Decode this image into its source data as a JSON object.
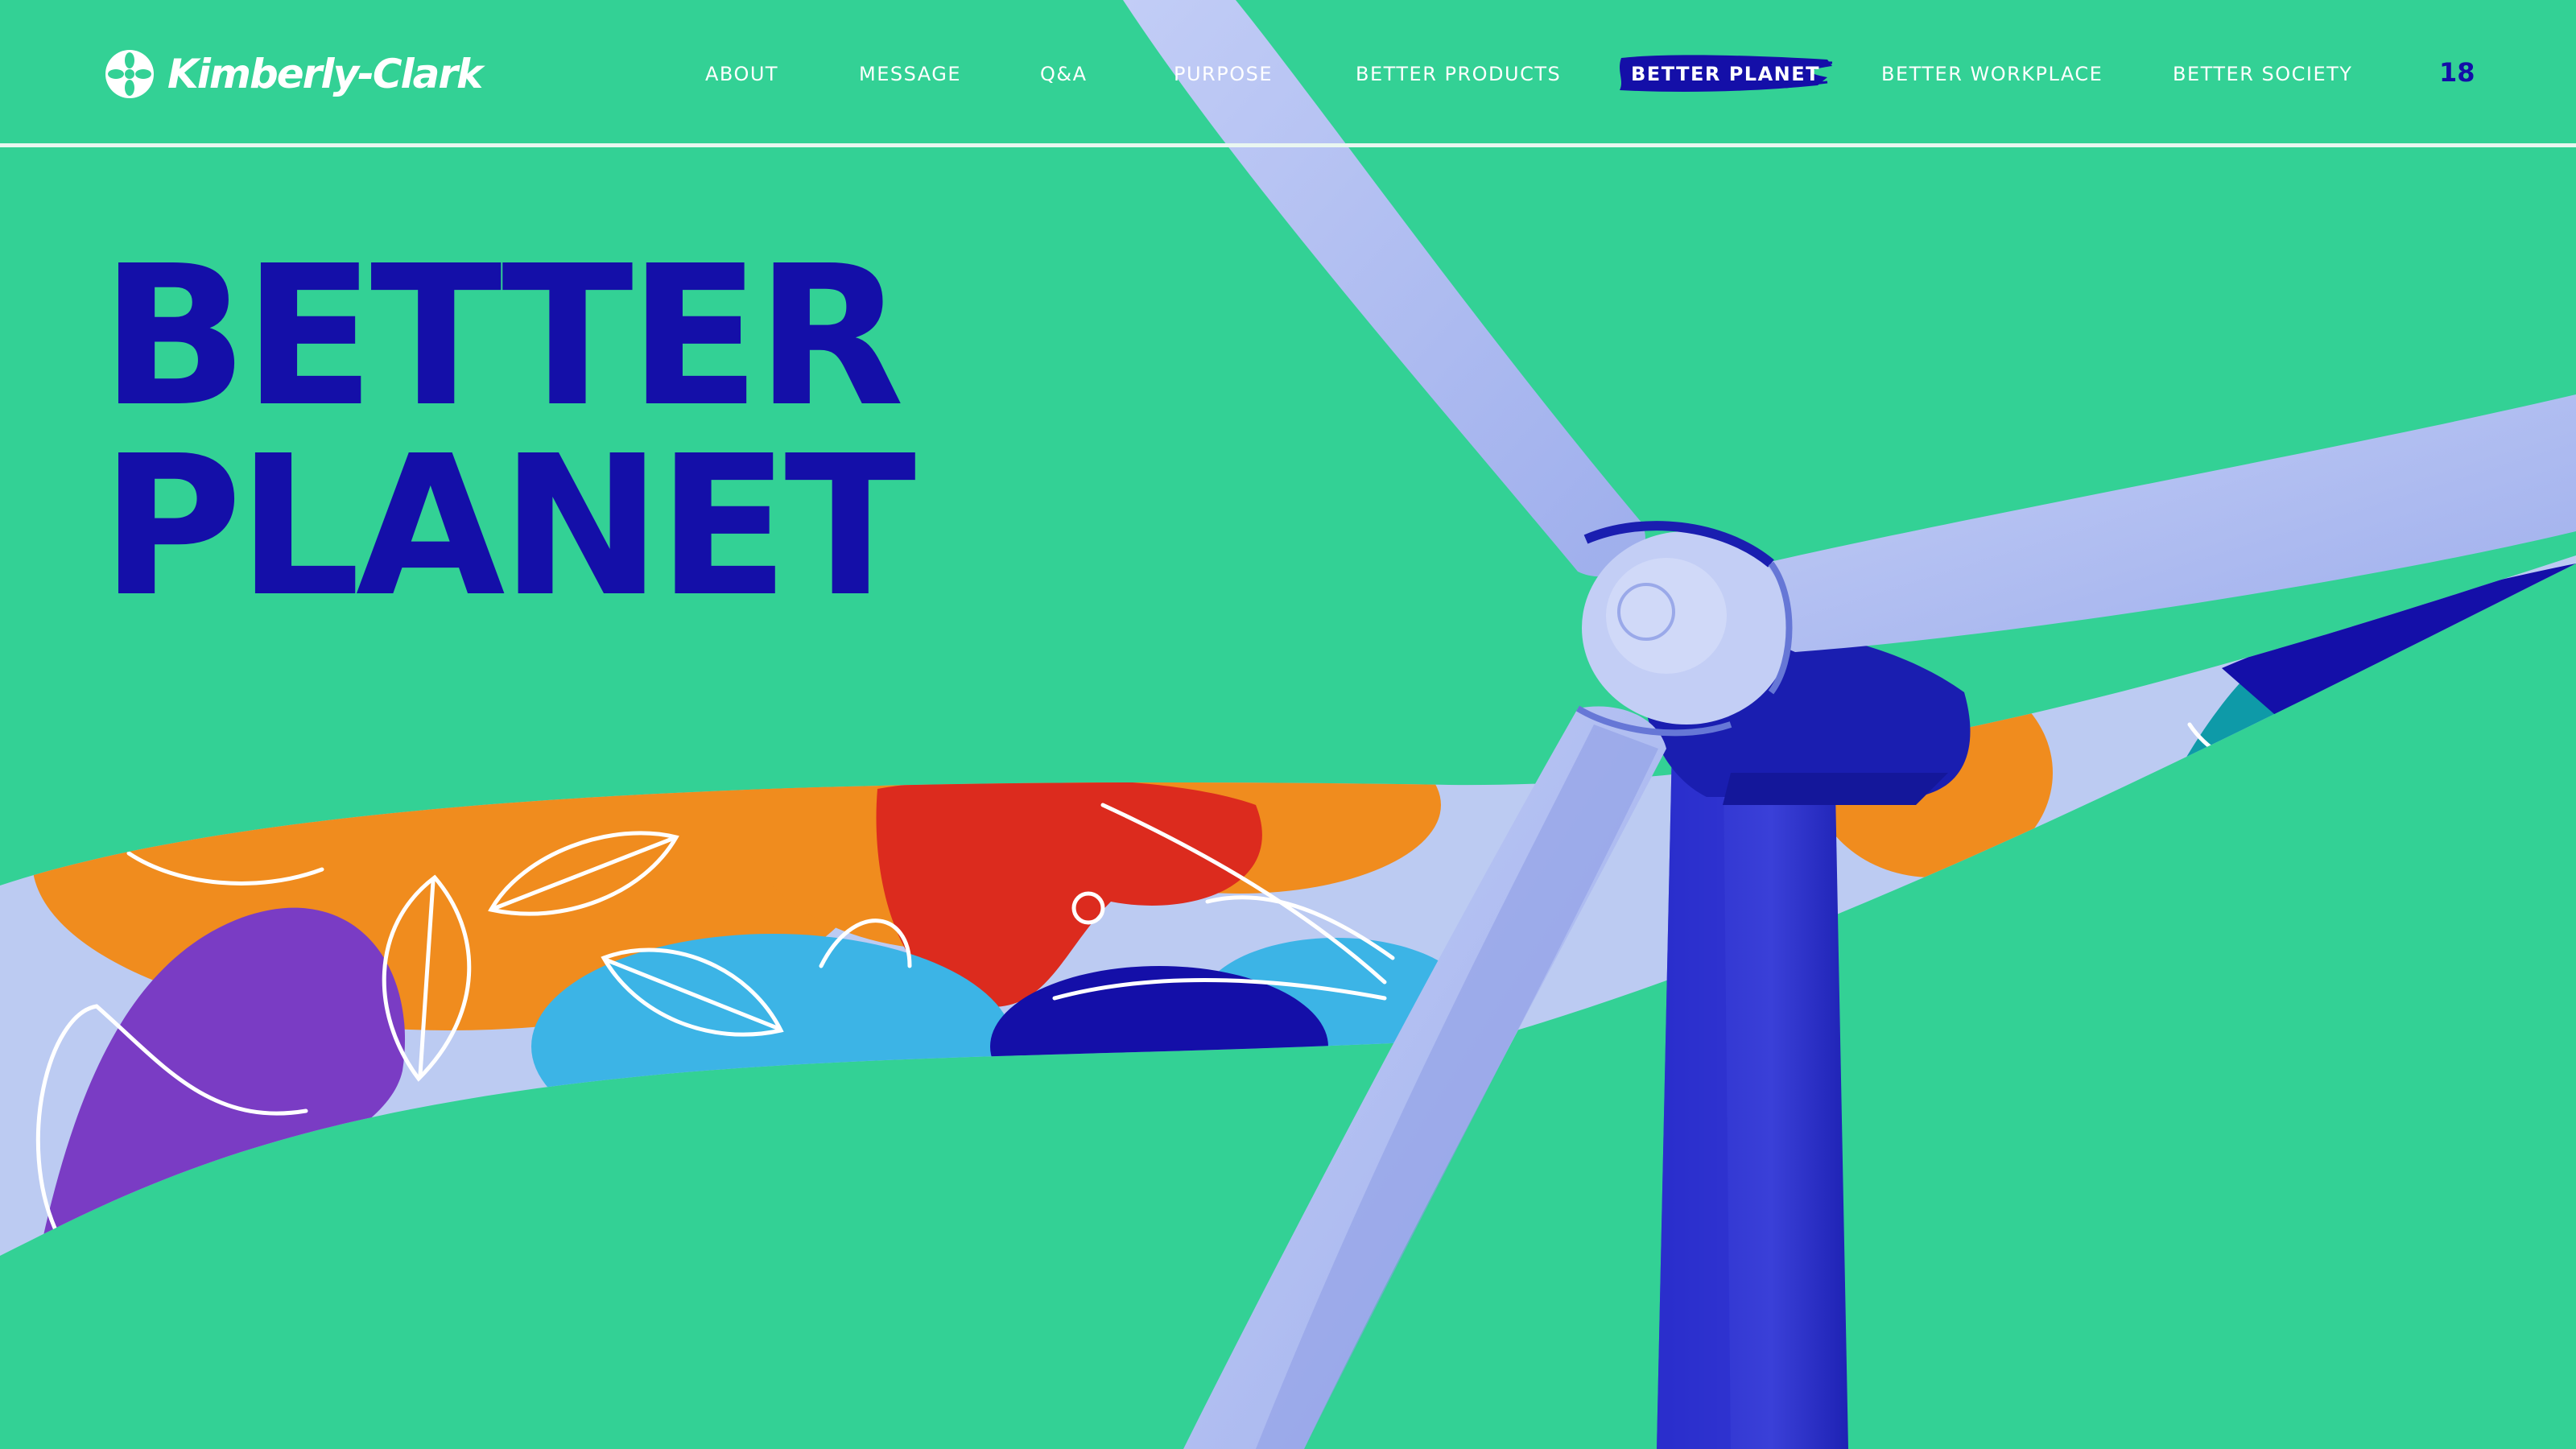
{
  "brand": {
    "name": "Kimberly-Clark"
  },
  "nav": {
    "items": [
      {
        "label": "ABOUT"
      },
      {
        "label": "MESSAGE"
      },
      {
        "label": "Q&A"
      },
      {
        "label": "PURPOSE"
      },
      {
        "label": "BETTER PRODUCTS"
      },
      {
        "label": "BETTER PLANET",
        "active": true
      },
      {
        "label": "BETTER WORKPLACE"
      },
      {
        "label": "BETTER SOCIETY"
      }
    ],
    "page_number": "18"
  },
  "hero": {
    "title_line1": "BETTER",
    "title_line2": "PLANET"
  },
  "colors": {
    "background": "#33D195",
    "title": "#140FA8",
    "turbine": "#B4C2F2",
    "turbine_shadow": "#2828C8",
    "ribbon_orange": "#F08C1E",
    "ribbon_red": "#DC2B1E",
    "ribbon_purple": "#7A3CC4",
    "ribbon_sky": "#3CB4E6",
    "ribbon_teal": "#0E9AA8"
  },
  "icons": {
    "logo": "kimberly-clark-flower-icon"
  }
}
